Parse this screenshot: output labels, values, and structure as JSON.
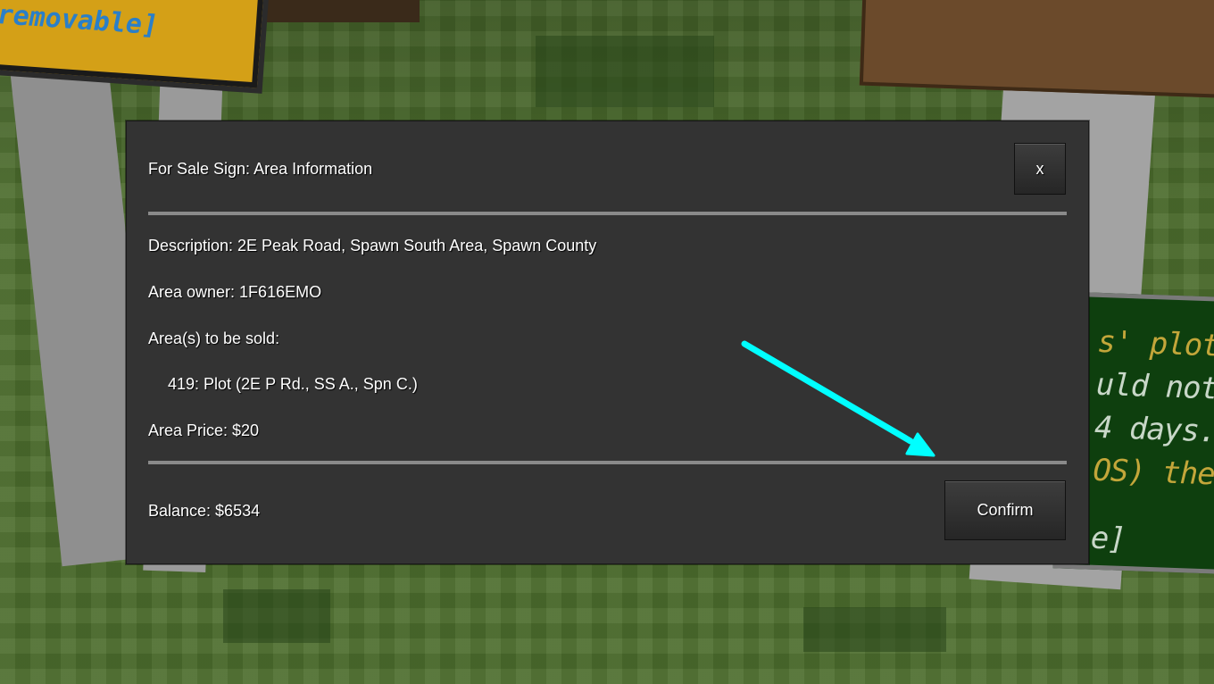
{
  "dialog": {
    "title": "For Sale Sign: Area Information",
    "close_label": "x",
    "description": "Description: 2E Peak Road, Spawn South Area, Spawn County",
    "owner": "Area owner: 1F616EMO",
    "areas_label": "Area(s) to be sold:",
    "areas": [
      "419: Plot (2E P Rd., SS A., Spn C.)"
    ],
    "price": "Area Price: $20",
    "balance": "Balance: $6534",
    "confirm_label": "Confirm"
  },
  "background": {
    "yellow_sign_text": "removable]",
    "green_sign_lines": [
      "s' plot. Acc",
      "uld not kee",
      "4 days.",
      "OS) the \"SA",
      "e]"
    ]
  },
  "colors": {
    "dialog_bg": "#333333",
    "divider": "#8a8a8a",
    "arrow": "#00ffff"
  }
}
